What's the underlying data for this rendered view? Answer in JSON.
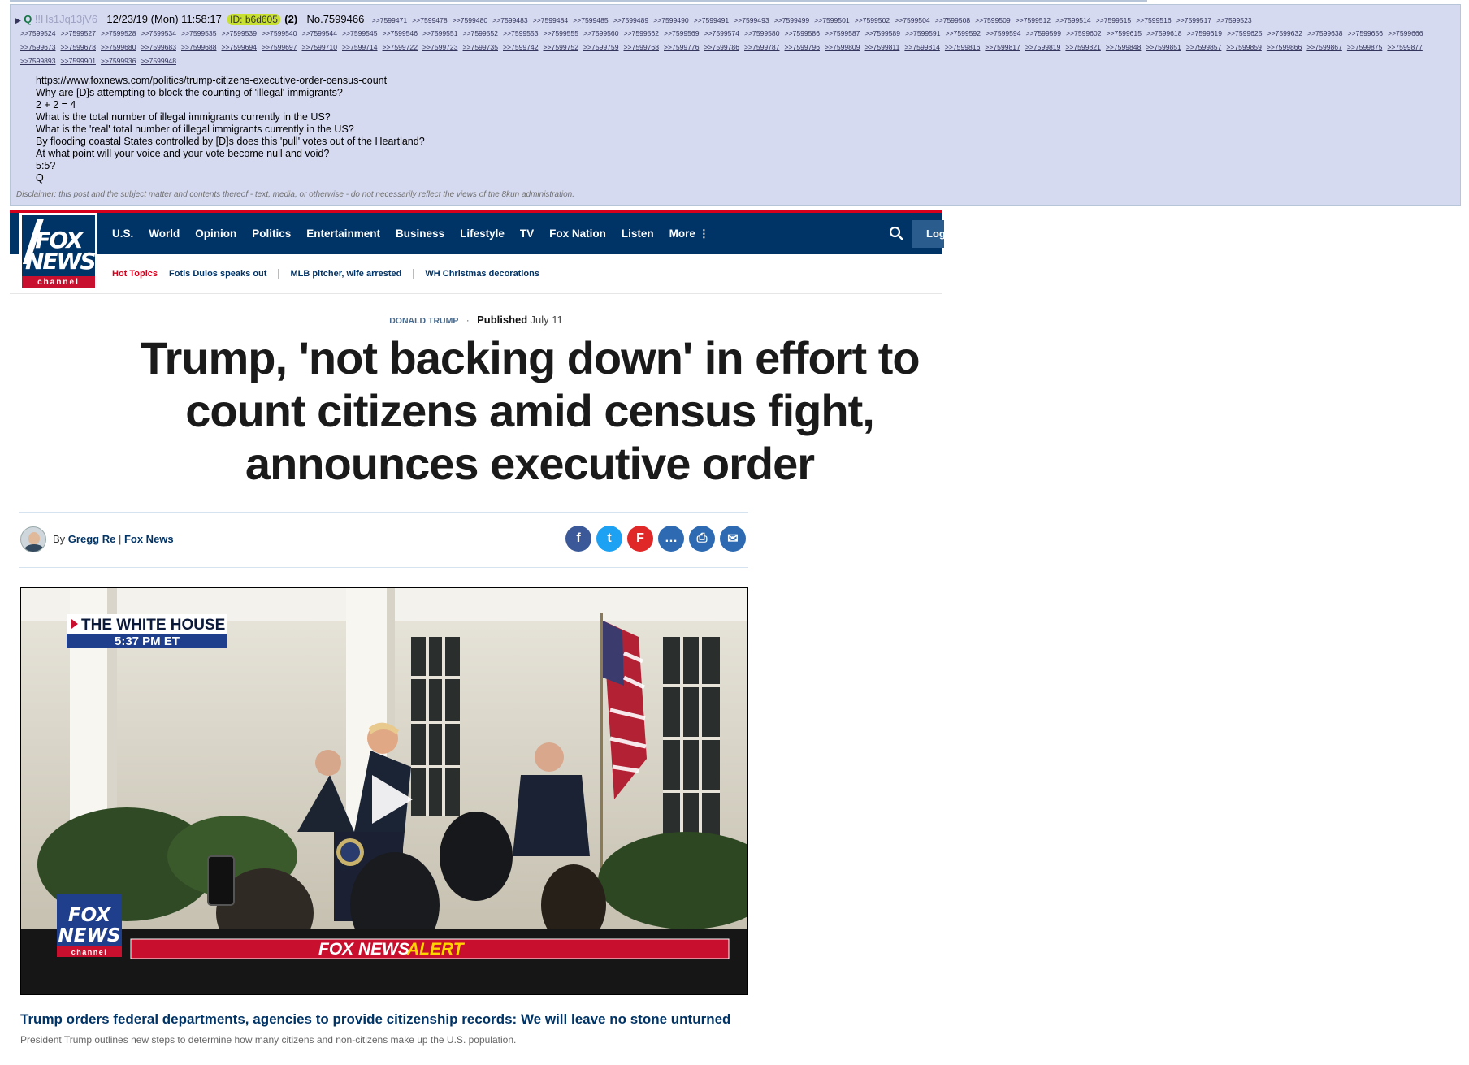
{
  "post": {
    "arrow": "▶",
    "name": "Q",
    "tripcode": "!!Hs1Jq13jV6",
    "date": "12/23/19 (Mon) 11:58:17",
    "id_label": "ID: b6d605",
    "reply_count": "(2)",
    "number": "No.7599466",
    "backlinks": [
      ">>7599471",
      ">>7599478",
      ">>7599480",
      ">>7599483",
      ">>7599484",
      ">>7599485",
      ">>7599489",
      ">>7599490",
      ">>7599491",
      ">>7599493",
      ">>7599499",
      ">>7599501",
      ">>7599502",
      ">>7599504",
      ">>7599508",
      ">>7599509",
      ">>7599512",
      ">>7599514",
      ">>7599515",
      ">>7599516",
      ">>7599517",
      ">>7599523",
      ">>7599524",
      ">>7599527",
      ">>7599528",
      ">>7599534",
      ">>7599535",
      ">>7599539",
      ">>7599540",
      ">>7599544",
      ">>7599545",
      ">>7599546",
      ">>7599551",
      ">>7599552",
      ">>7599553",
      ">>7599555",
      ">>7599560",
      ">>7599562",
      ">>7599569",
      ">>7599574",
      ">>7599580",
      ">>7599586",
      ">>7599587",
      ">>7599589",
      ">>7599591",
      ">>7599592",
      ">>7599594",
      ">>7599599",
      ">>7599602",
      ">>7599615",
      ">>7599618",
      ">>7599619",
      ">>7599625",
      ">>7599632",
      ">>7599638",
      ">>7599656",
      ">>7599666",
      ">>7599673",
      ">>7599678",
      ">>7599680",
      ">>7599683",
      ">>7599688",
      ">>7599694",
      ">>7599697",
      ">>7599710",
      ">>7599714",
      ">>7599722",
      ">>7599723",
      ">>7599735",
      ">>7599742",
      ">>7599752",
      ">>7599759",
      ">>7599768",
      ">>7599776",
      ">>7599786",
      ">>7599787",
      ">>7599796",
      ">>7599809",
      ">>7599811",
      ">>7599814",
      ">>7599816",
      ">>7599817",
      ">>7599819",
      ">>7599821",
      ">>7599848",
      ">>7599851",
      ">>7599857",
      ">>7599859",
      ">>7599866",
      ">>7599867",
      ">>7599875",
      ">>7599877",
      ">>7599893",
      ">>7599901",
      ">>7599936",
      ">>7599948"
    ],
    "body_lines": [
      "https://www.foxnews.com/politics/trump-citizens-executive-order-census-count",
      "Why are [D]s attempting to block the counting of 'illegal' immigrants?",
      "2 + 2 = 4",
      "What is the total number of illegal immigrants currently in the US?",
      "What is the 'real' total number of illegal immigrants currently in the US?",
      "By flooding coastal States controlled by [D]s does this 'pull' votes out of the Heartland?",
      "At what point will your voice and your vote become null and void?",
      "5:5?",
      "Q"
    ],
    "disclaimer": "Disclaimer: this post and the subject matter and contents thereof - text, media, or otherwise - do not necessarily reflect the views of the 8kun administration."
  },
  "foxnews": {
    "logo": {
      "line1": "FOX",
      "line2": "NEWS",
      "channel": "channel"
    },
    "nav": [
      "U.S.",
      "World",
      "Opinion",
      "Politics",
      "Entertainment",
      "Business",
      "Lifestyle",
      "TV",
      "Fox Nation",
      "Listen",
      "More ⋮"
    ],
    "login": "Login",
    "hot_topics_label": "Hot Topics",
    "hot_topics": [
      "Fotis Dulos speaks out",
      "MLB pitcher, wife arrested",
      "WH Christmas decorations"
    ],
    "category": "DONALD TRUMP",
    "published_label": "Published",
    "published_date": "July 11",
    "headline": "Trump, 'not backing down' in effort to count citizens amid census fight, announces executive order",
    "byline_prefix": "By",
    "author": "Gregg Re",
    "byline_sep": "|",
    "outlet": "Fox News",
    "share": [
      {
        "icon": "facebook-icon",
        "glyph": "f",
        "color": "#3b5998"
      },
      {
        "icon": "twitter-icon",
        "glyph": "t",
        "color": "#1da1f2"
      },
      {
        "icon": "flipboard-icon",
        "glyph": "F",
        "color": "#e12828"
      },
      {
        "icon": "comments-icon",
        "glyph": "…",
        "color": "#2d6ab1"
      },
      {
        "icon": "print-icon",
        "glyph": "⎙",
        "color": "#2d6ab1"
      },
      {
        "icon": "email-icon",
        "glyph": "✉",
        "color": "#2d6ab1"
      }
    ],
    "video": {
      "location_tag": "THE WHITE HOUSE",
      "time_tag": "5:37 PM ET",
      "alert_prefix": "FOX NEWS",
      "alert_word": "ALERT",
      "bug_line1": "FOX",
      "bug_line2": "NEWS",
      "bug_channel": "channel"
    },
    "video_title": "Trump orders federal departments, agencies to provide citizenship records: We will leave no stone unturned",
    "video_desc": "President Trump outlines new steps to determine how many citizens and non-citizens make up the U.S. population."
  }
}
